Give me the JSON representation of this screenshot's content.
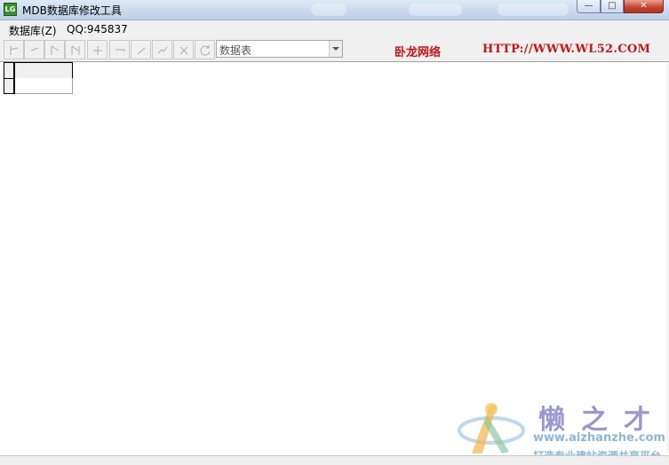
{
  "window": {
    "title": "MDB数据库修改工具",
    "icon_text": "LG",
    "buttons": {
      "minimize": "—",
      "maximize": "□",
      "close": "✕"
    }
  },
  "menu": {
    "items": [
      {
        "label": "数据库(Z)"
      },
      {
        "label": "QQ:945837"
      }
    ]
  },
  "toolbar": {
    "nav_icons": [
      "first-icon",
      "prev-icon",
      "next-icon",
      "last-icon",
      "insert-icon",
      "delete-icon",
      "edit-icon",
      "post-icon",
      "cancel-icon",
      "refresh-icon"
    ],
    "table_combo": {
      "value": "数据表"
    },
    "brand_name": "卧龙网络",
    "brand_url": "HTTP://WWW.WL52.COM"
  },
  "watermark": {
    "title": "懒之才",
    "url": "www.aizhanzhe.com",
    "subtitle": "打造专业建站资源共享平台"
  },
  "colors": {
    "brand_red": "#c81414",
    "title_bar": "#c9d9ec",
    "close_red": "#c7412a"
  }
}
